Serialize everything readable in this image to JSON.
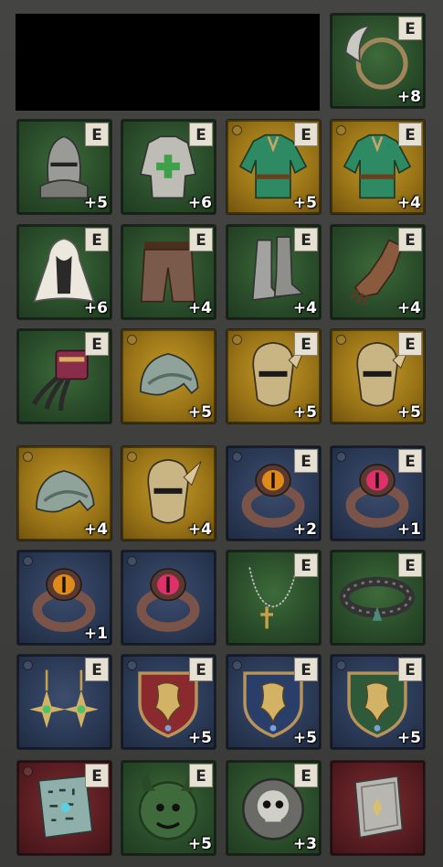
{
  "inventory": {
    "hidden_region": "redacted",
    "slots": [
      {
        "item": "ring-scythe-necklace",
        "bg": "green",
        "equipped_label": "E",
        "level": "+8",
        "locked": false
      },
      {
        "item": "great-helm",
        "bg": "green",
        "equipped_label": "E",
        "level": "+5",
        "locked": false
      },
      {
        "item": "white-tabard",
        "bg": "green",
        "equipped_label": "E",
        "level": "+6",
        "locked": false
      },
      {
        "item": "green-jerkin",
        "bg": "gold",
        "equipped_label": "E",
        "level": "+5",
        "locked": true
      },
      {
        "item": "green-jerkin",
        "bg": "gold",
        "equipped_label": "E",
        "level": "+4",
        "locked": true
      },
      {
        "item": "white-cloak",
        "bg": "green",
        "equipped_label": "E",
        "level": "+6",
        "locked": false
      },
      {
        "item": "leather-trousers",
        "bg": "green",
        "equipped_label": "E",
        "level": "+4",
        "locked": false
      },
      {
        "item": "plate-boots",
        "bg": "green",
        "equipped_label": "E",
        "level": "+4",
        "locked": false
      },
      {
        "item": "leather-gauntlet",
        "bg": "green",
        "equipped_label": "E",
        "level": "+4",
        "locked": false
      },
      {
        "item": "claw-bracer",
        "bg": "green",
        "equipped_label": "E",
        "level": "",
        "locked": false
      },
      {
        "item": "steel-pauldron",
        "bg": "gold",
        "equipped_label": "",
        "level": "+5",
        "locked": true
      },
      {
        "item": "gilded-mask",
        "bg": "gold",
        "equipped_label": "E",
        "level": "+5",
        "locked": true
      },
      {
        "item": "gilded-mask",
        "bg": "gold",
        "equipped_label": "E",
        "level": "+5",
        "locked": true
      },
      {
        "item": "steel-pauldron",
        "bg": "gold",
        "equipped_label": "",
        "level": "+4",
        "locked": true
      },
      {
        "item": "gilded-mask",
        "bg": "gold",
        "equipped_label": "",
        "level": "+4",
        "locked": true
      },
      {
        "item": "eye-ring-orange",
        "bg": "blue",
        "equipped_label": "E",
        "level": "+2",
        "locked": true
      },
      {
        "item": "eye-ring-red",
        "bg": "blue",
        "equipped_label": "E",
        "level": "+1",
        "locked": true
      },
      {
        "item": "eye-ring-orange",
        "bg": "blue",
        "equipped_label": "",
        "level": "+1",
        "locked": true
      },
      {
        "item": "eye-ring-red",
        "bg": "blue",
        "equipped_label": "",
        "level": "",
        "locked": true
      },
      {
        "item": "cross-necklace",
        "bg": "green",
        "equipped_label": "E",
        "level": "",
        "locked": false
      },
      {
        "item": "spiked-collar",
        "bg": "green",
        "equipped_label": "E",
        "level": "",
        "locked": false
      },
      {
        "item": "star-earrings",
        "bg": "blue",
        "equipped_label": "E",
        "level": "",
        "locked": true
      },
      {
        "item": "lion-shield-red",
        "bg": "blue",
        "equipped_label": "E",
        "level": "+5",
        "locked": true
      },
      {
        "item": "lion-shield-blue",
        "bg": "blue",
        "equipped_label": "E",
        "level": "+5",
        "locked": true
      },
      {
        "item": "lion-shield-green",
        "bg": "blue",
        "equipped_label": "E",
        "level": "+5",
        "locked": true
      },
      {
        "item": "rune-tablet",
        "bg": "red",
        "equipped_label": "E",
        "level": "",
        "locked": true
      },
      {
        "item": "horned-demon-relic",
        "bg": "green",
        "equipped_label": "E",
        "level": "+5",
        "locked": false
      },
      {
        "item": "skull-relic",
        "bg": "green",
        "equipped_label": "E",
        "level": "+3",
        "locked": false
      },
      {
        "item": "stone-tome",
        "bg": "red",
        "equipped_label": "",
        "level": "",
        "locked": false
      }
    ]
  }
}
